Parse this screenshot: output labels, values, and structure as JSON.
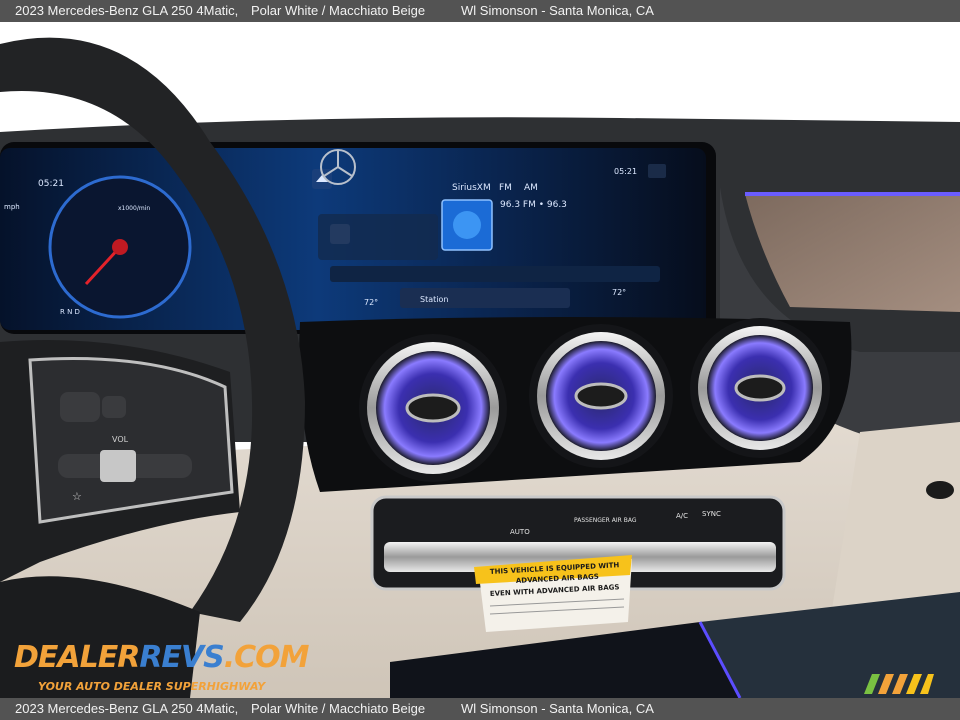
{
  "header": {
    "vehicle": "2023 Mercedes-Benz GLA 250 4Matic,",
    "colors": "Polar White / Macchiato Beige",
    "dealer": "Wl Simonson - Santa Monica, CA"
  },
  "footer": {
    "vehicle": "2023 Mercedes-Benz GLA 250 4Matic,",
    "colors": "Polar White / Macchiato Beige",
    "dealer": "Wl Simonson - Santa Monica, CA"
  },
  "watermark": {
    "logo_part1": "DEALER",
    "logo_part2": "REVS",
    "logo_part3": ".COM",
    "tagline": "YOUR AUTO DEALER SUPERHIGHWAY"
  },
  "screen": {
    "time_left": "05:21",
    "time_right": "05:21",
    "mph_label": "mph",
    "rpm_label": "x1000/min",
    "source_siriusxm": "SiriusXM",
    "source_fm": "FM",
    "source_am": "AM",
    "frequency": "96.3 FM • 96.3",
    "station_label": "Station",
    "temp_left": "72°",
    "temp_right": "72°",
    "gear": "R N D"
  },
  "controls": {
    "auto": "AUTO",
    "passenger_airbag": "PASSENGER AIR BAG",
    "ac": "A/C",
    "sync": "SYNC",
    "vol": "VOL"
  },
  "airbag_label": {
    "line1": "THIS VEHICLE IS EQUIPPED WITH",
    "line2": "ADVANCED AIR BAGS",
    "line3": "EVEN WITH ADVANCED AIR BAGS"
  },
  "colors": {
    "bar_bg": "#535353",
    "ambient_blue": "#6a5cff",
    "dash_dark": "#2b2d30",
    "dash_beige": "#d8cfc4",
    "label_yellow": "#f7c21b"
  }
}
